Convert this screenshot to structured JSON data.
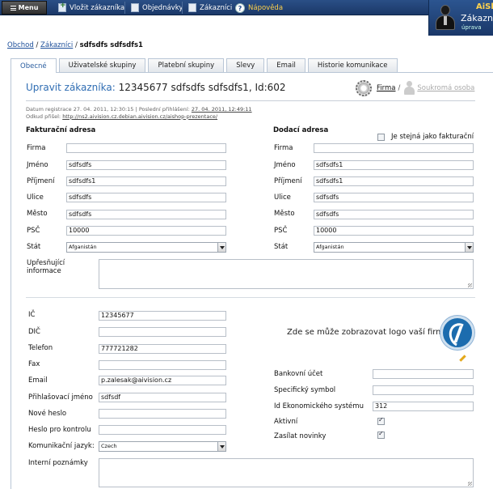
{
  "topbar": {
    "menu_label": "Menu",
    "nav": [
      {
        "label": "Vložit zákazníka",
        "icon": "add-document-icon"
      },
      {
        "label": "Objednávky",
        "icon": "document-icon"
      },
      {
        "label": "Zákazníci",
        "icon": "document-icon"
      },
      {
        "label": "Nápověda",
        "icon": "help-icon"
      }
    ]
  },
  "user_panel": {
    "brand": "AiSh",
    "title": "Zákazníci",
    "subtitle": "úprava"
  },
  "breadcrumb": {
    "items": [
      "Obchod",
      "Zákazníci"
    ],
    "separator": "/",
    "current": "sdfsdfs sdfsdfs1"
  },
  "tabs": [
    {
      "label": "Obecné",
      "active": true
    },
    {
      "label": "Uživatelské skupiny",
      "active": false
    },
    {
      "label": "Platební skupiny",
      "active": false
    },
    {
      "label": "Slevy",
      "active": false
    },
    {
      "label": "Email",
      "active": false
    },
    {
      "label": "Historie komunikace",
      "active": false
    }
  ],
  "heading": {
    "label": "Upravit zákazníka:",
    "value": "12345677 sdfsdfs sdfsdfs1, Id:602"
  },
  "customer_type": {
    "firma": "Firma",
    "separator": "/",
    "soukroma": "Soukromá osoba"
  },
  "meta": {
    "registration_label": "Datum registrace",
    "registration": "27. 04. 2011, 12:30:15",
    "separator": "|",
    "last_login_label": "Poslední přihlášení:",
    "last_login": "27. 04. 2011, 12:49:11",
    "source_label": "Odkud přišel:",
    "source": "http://ns2.aivision.cz.debian.aivision.cz/aishop-prezentace/"
  },
  "billing": {
    "title": "Fakturační adresa",
    "fields": [
      {
        "label": "Firma",
        "value": ""
      },
      {
        "label": "Jméno",
        "value": "sdfsdfs"
      },
      {
        "label": "Příjmení",
        "value": "sdfsdfs1"
      },
      {
        "label": "Ulice",
        "value": "sdfsdfs"
      },
      {
        "label": "Město",
        "value": "sdfsdfs"
      },
      {
        "label": "PSČ",
        "value": "10000"
      }
    ],
    "country_label": "Stát",
    "country_value": "Afganistán"
  },
  "delivery": {
    "title": "Dodací adresa",
    "same_as_billing_label": "Je stejná jako fakturační",
    "same_as_billing": false,
    "fields": [
      {
        "label": "Firma",
        "value": ""
      },
      {
        "label": "Jméno",
        "value": "sdfsdfs1"
      },
      {
        "label": "Příjmení",
        "value": "sdfsdfs1"
      },
      {
        "label": "Ulice",
        "value": "sdfsdfs"
      },
      {
        "label": "Město",
        "value": "sdfsdfs"
      },
      {
        "label": "PSČ",
        "value": "10000"
      }
    ],
    "country_label": "Stát",
    "country_value": "Afganistán"
  },
  "additional_info": {
    "label_line1": "Upřesňující",
    "label_line2": "informace",
    "value": ""
  },
  "company": {
    "fields": [
      {
        "label": "IČ",
        "value": "12345677"
      },
      {
        "label": "DIČ",
        "value": ""
      },
      {
        "label": "Telefon",
        "value": "777721282"
      },
      {
        "label": "Fax",
        "value": ""
      },
      {
        "label": "Email",
        "value": "p.zalesak@aivision.cz"
      },
      {
        "label": "Přihlašovací jméno",
        "value": "sdfsdf"
      },
      {
        "label": "Nové heslo",
        "value": ""
      },
      {
        "label": "Heslo pro kontrolu",
        "value": ""
      }
    ],
    "language_label": "Komunikační jazyk:",
    "language_value": "Czech",
    "notes_label": "Interní poznámky",
    "notes_value": ""
  },
  "logo": {
    "text": "Zde se může zobrazovat logo vaší firmy."
  },
  "bank": {
    "fields": [
      {
        "label": "Bankovní účet",
        "value": ""
      },
      {
        "label": "Specifický symbol",
        "value": ""
      },
      {
        "label": "Id Ekonomického systému",
        "value": "312"
      }
    ],
    "active_label": "Aktivní",
    "active": true,
    "newsletter_label": "Zasílat novinky",
    "newsletter": true
  }
}
